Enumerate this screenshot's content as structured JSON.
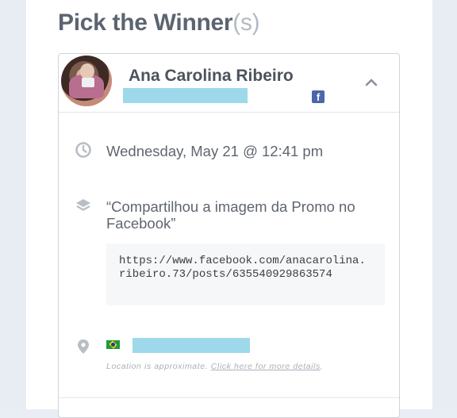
{
  "page": {
    "title_main": "Pick the Winner",
    "title_suffix": "(s)"
  },
  "winner": {
    "name": "Ana Carolina Ribeiro",
    "social_icon": "facebook-icon",
    "expanded_icon": "chevron-up-icon"
  },
  "entry": {
    "datetime": "Wednesday, May 21 @ 12:41 pm",
    "action": "“Compartilhou a imagem da Promo no Facebook”",
    "url": "https://www.facebook.com/anacarolina.ribeiro.73/posts/635540929863574"
  },
  "location": {
    "flag": "brazil-flag",
    "note_text": "Location is approximate. ",
    "note_link": "Click here for more details",
    "note_end": "."
  },
  "icons": {
    "clock": "clock-icon",
    "layers": "layers-icon",
    "pin": "map-pin-icon"
  },
  "colors": {
    "redaction": "#9dd9ea",
    "facebook": "#4a67a8"
  }
}
